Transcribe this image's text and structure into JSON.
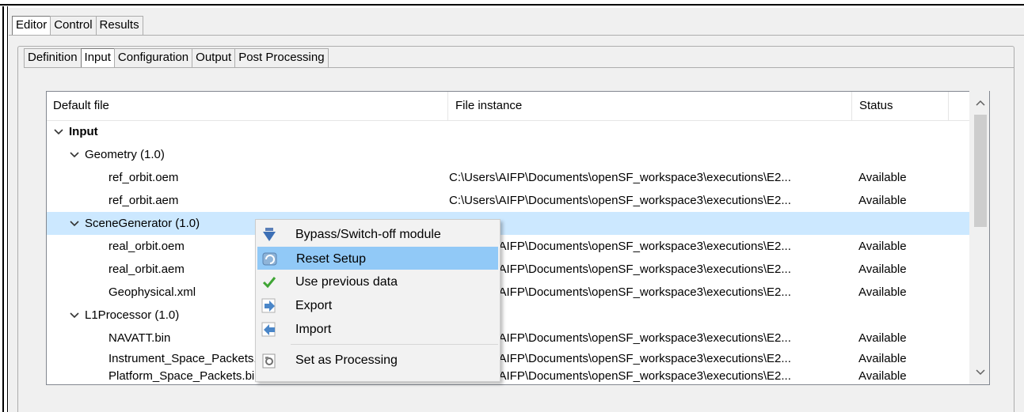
{
  "top_tabs": [
    {
      "label": "Editor",
      "active": true
    },
    {
      "label": "Control",
      "active": false
    },
    {
      "label": "Results",
      "active": false
    }
  ],
  "sub_tabs": [
    {
      "label": "Definition",
      "active": false
    },
    {
      "label": "Input",
      "active": true
    },
    {
      "label": "Configuration",
      "active": false
    },
    {
      "label": "Output",
      "active": false
    },
    {
      "label": "Post Processing",
      "active": false
    }
  ],
  "table": {
    "columns": [
      "Default file",
      "File instance",
      "Status"
    ],
    "rows": [
      {
        "level": 0,
        "expandable": true,
        "bold": true,
        "name": "Input",
        "instance": "",
        "status": ""
      },
      {
        "level": 1,
        "expandable": true,
        "name": "Geometry (1.0)",
        "instance": "",
        "status": ""
      },
      {
        "level": 2,
        "name": "ref_orbit.oem",
        "instance": "C:\\Users\\AIFP\\Documents\\openSF_workspace3\\executions\\E2...",
        "status": "Available"
      },
      {
        "level": 2,
        "name": "ref_orbit.aem",
        "instance": "C:\\Users\\AIFP\\Documents\\openSF_workspace3\\executions\\E2...",
        "status": "Available"
      },
      {
        "level": 1,
        "expandable": true,
        "selected": true,
        "name": "SceneGenerator (1.0)",
        "instance": "",
        "status": ""
      },
      {
        "level": 2,
        "name": "real_orbit.oem",
        "instance": "C:\\Users\\AIFP\\Documents\\openSF_workspace3\\executions\\E2...",
        "status": "Available"
      },
      {
        "level": 2,
        "name": "real_orbit.aem",
        "instance": "C:\\Users\\AIFP\\Documents\\openSF_workspace3\\executions\\E2...",
        "status": "Available"
      },
      {
        "level": 2,
        "name": "Geophysical.xml",
        "instance": "C:\\Users\\AIFP\\Documents\\openSF_workspace3\\executions\\E2...",
        "status": "Available"
      },
      {
        "level": 1,
        "expandable": true,
        "name": "L1Processor (1.0)",
        "instance": "",
        "status": ""
      },
      {
        "level": 2,
        "name": "NAVATT.bin",
        "instance": "C:\\Users\\AIFP\\Documents\\openSF_workspace3\\executions\\E2...",
        "status": "Available"
      },
      {
        "level": 2,
        "name": "Instrument_Space_Packets.bin",
        "instance": "C:\\Users\\AIFP\\Documents\\openSF_workspace3\\executions\\E2...",
        "status": "Available"
      },
      {
        "level": 2,
        "name": "Platform_Space_Packets.bin",
        "instance": "C:\\Users\\AIFP\\Documents\\openSF_workspace3\\executions\\E2...",
        "status": "Available"
      }
    ]
  },
  "context_menu": {
    "items": [
      {
        "label": "Bypass/Switch-off module",
        "icon": "bypass-arrow-icon",
        "highlighted": false
      },
      {
        "label": "Reset Setup",
        "icon": "reset-icon",
        "highlighted": true
      },
      {
        "label": "Use previous data",
        "icon": "checkmark-icon",
        "highlighted": false
      },
      {
        "label": "Export",
        "icon": "export-arrow-icon",
        "highlighted": false
      },
      {
        "label": "Import",
        "icon": "import-arrow-icon",
        "highlighted": false
      },
      {
        "label": "Set as Processing",
        "icon": "processing-icon",
        "highlighted": false
      }
    ]
  },
  "colors": {
    "selection": "#cce8ff",
    "menu_highlight": "#91c9f7",
    "checkmark": "#3fa535"
  }
}
